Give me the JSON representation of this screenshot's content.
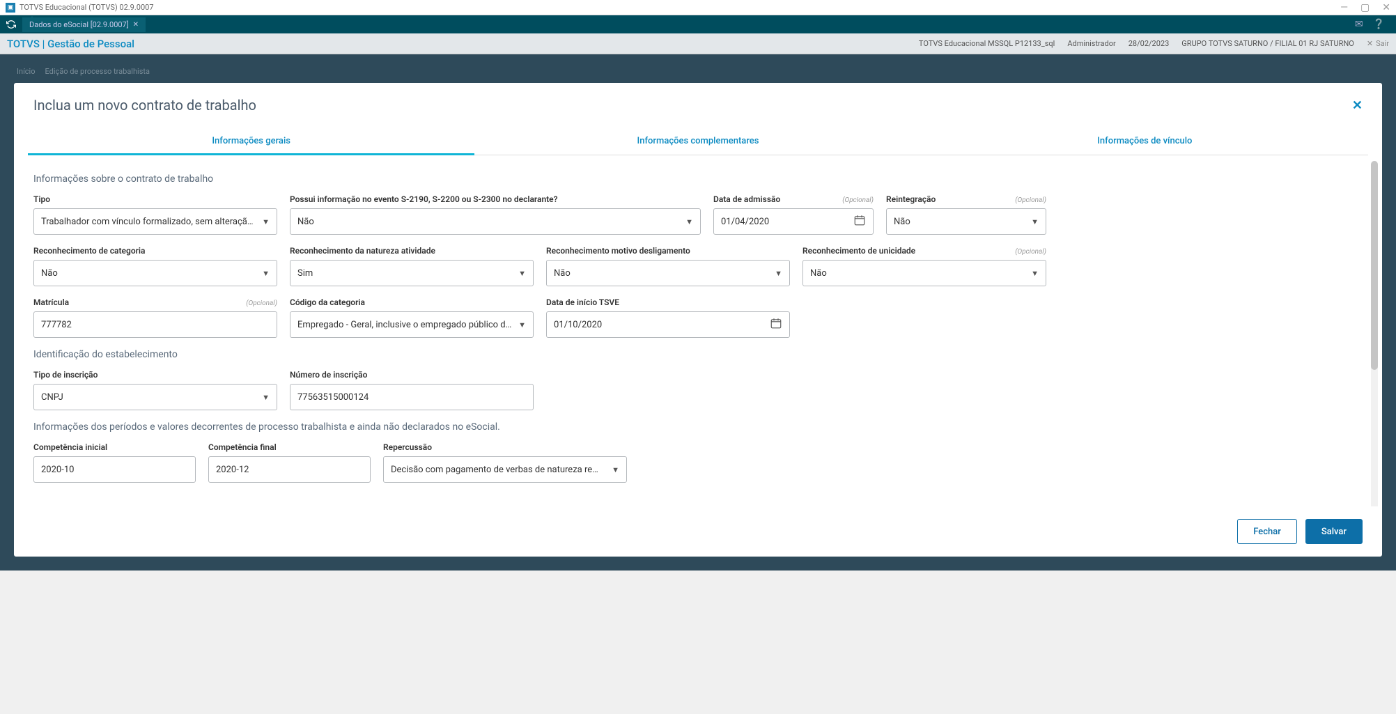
{
  "titlebar": {
    "title": "TOTVS Educacional (TOTVS) 02.9.0007"
  },
  "tabbar": {
    "tab_label": "Dados do eSocial [02.9.0007]"
  },
  "brandbar": {
    "title": "TOTVS | Gestão de Pessoal",
    "env": "TOTVS Educacional MSSQL P12133_sql",
    "user": "Administrador",
    "date": "28/02/2023",
    "org": "GRUPO TOTVS SATURNO / FILIAL 01 RJ SATURNO",
    "exit": "Sair"
  },
  "breadcrumb": {
    "a": "Início",
    "b": "Edição de processo trabalhista"
  },
  "card": {
    "title": "Inclua um novo contrato de trabalho"
  },
  "tabs": {
    "t1": "Informações gerais",
    "t2": "Informações complementares",
    "t3": "Informações de vínculo"
  },
  "section1": "Informações sobre o contrato de trabalho",
  "section2": "Identificação do estabelecimento",
  "section3": "Informações dos períodos e valores decorrentes de processo trabalhista e ainda não declarados no eSocial.",
  "optional": "(Opcional)",
  "fields": {
    "tipo": {
      "label": "Tipo",
      "value": "Trabalhador com vínculo formalizado, sem alteração nas"
    },
    "possui": {
      "label": "Possui informação no evento S-2190, S-2200 ou S-2300 no declarante?",
      "value": "Não"
    },
    "dataadm": {
      "label": "Data de admissão",
      "value": "01/04/2020"
    },
    "reint": {
      "label": "Reintegração",
      "value": "Não"
    },
    "reccat": {
      "label": "Reconhecimento de categoria",
      "value": "Não"
    },
    "recnat": {
      "label": "Reconhecimento da natureza atividade",
      "value": "Sim"
    },
    "recmot": {
      "label": "Reconhecimento motivo desligamento",
      "value": "Não"
    },
    "recuni": {
      "label": "Reconhecimento de unicidade",
      "value": "Não"
    },
    "matricula": {
      "label": "Matrícula",
      "value": "777782"
    },
    "codcat": {
      "label": "Código da categoria",
      "value": "Empregado - Geral, inclusive o empregado público da ad"
    },
    "datatsve": {
      "label": "Data de início TSVE",
      "value": "01/10/2020"
    },
    "tipoinsc": {
      "label": "Tipo de inscrição",
      "value": "CNPJ"
    },
    "numinsc": {
      "label": "Número de inscrição",
      "value": "77563515000124"
    },
    "compini": {
      "label": "Competência inicial",
      "value": "2020-10"
    },
    "compfim": {
      "label": "Competência final",
      "value": "2020-12"
    },
    "reperc": {
      "label": "Repercussão",
      "value": "Decisão com pagamento de verbas de natureza remunera"
    }
  },
  "footer": {
    "close": "Fechar",
    "save": "Salvar"
  }
}
